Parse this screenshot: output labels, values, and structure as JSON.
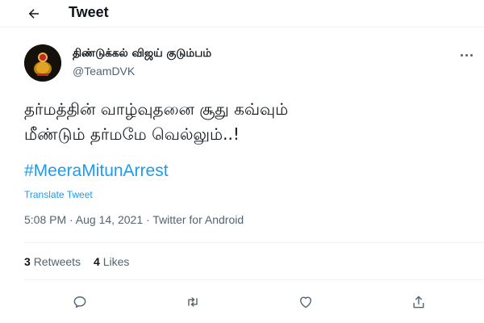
{
  "header": {
    "title": "Tweet",
    "back_icon": "arrow-left-icon"
  },
  "author": {
    "name": "திண்டுக்கல் விஜய் குடும்பம்",
    "handle": "@TeamDVK",
    "more_icon": "more-horizontal-icon"
  },
  "tweet": {
    "text_lines": [
      "தர்மத்தின் வாழ்வுதனை சூது கவ்வும்",
      "மீண்டும் தர்மமே வெல்லும்..!"
    ],
    "hashtag": "#MeeraMitunArrest",
    "translate_label": "Translate Tweet",
    "timestamp": "5:08 PM · Aug 14, 2021 · ",
    "source": "Twitter for Android"
  },
  "stats": {
    "retweets_count": "3",
    "retweets_label": "Retweets",
    "likes_count": "4",
    "likes_label": "Likes"
  },
  "actions": {
    "reply_icon": "reply-icon",
    "retweet_icon": "retweet-icon",
    "like_icon": "heart-icon",
    "share_icon": "share-icon"
  },
  "colors": {
    "link": "#1d9bf0",
    "secondary_text": "#536471",
    "primary_text": "#0f1419"
  }
}
